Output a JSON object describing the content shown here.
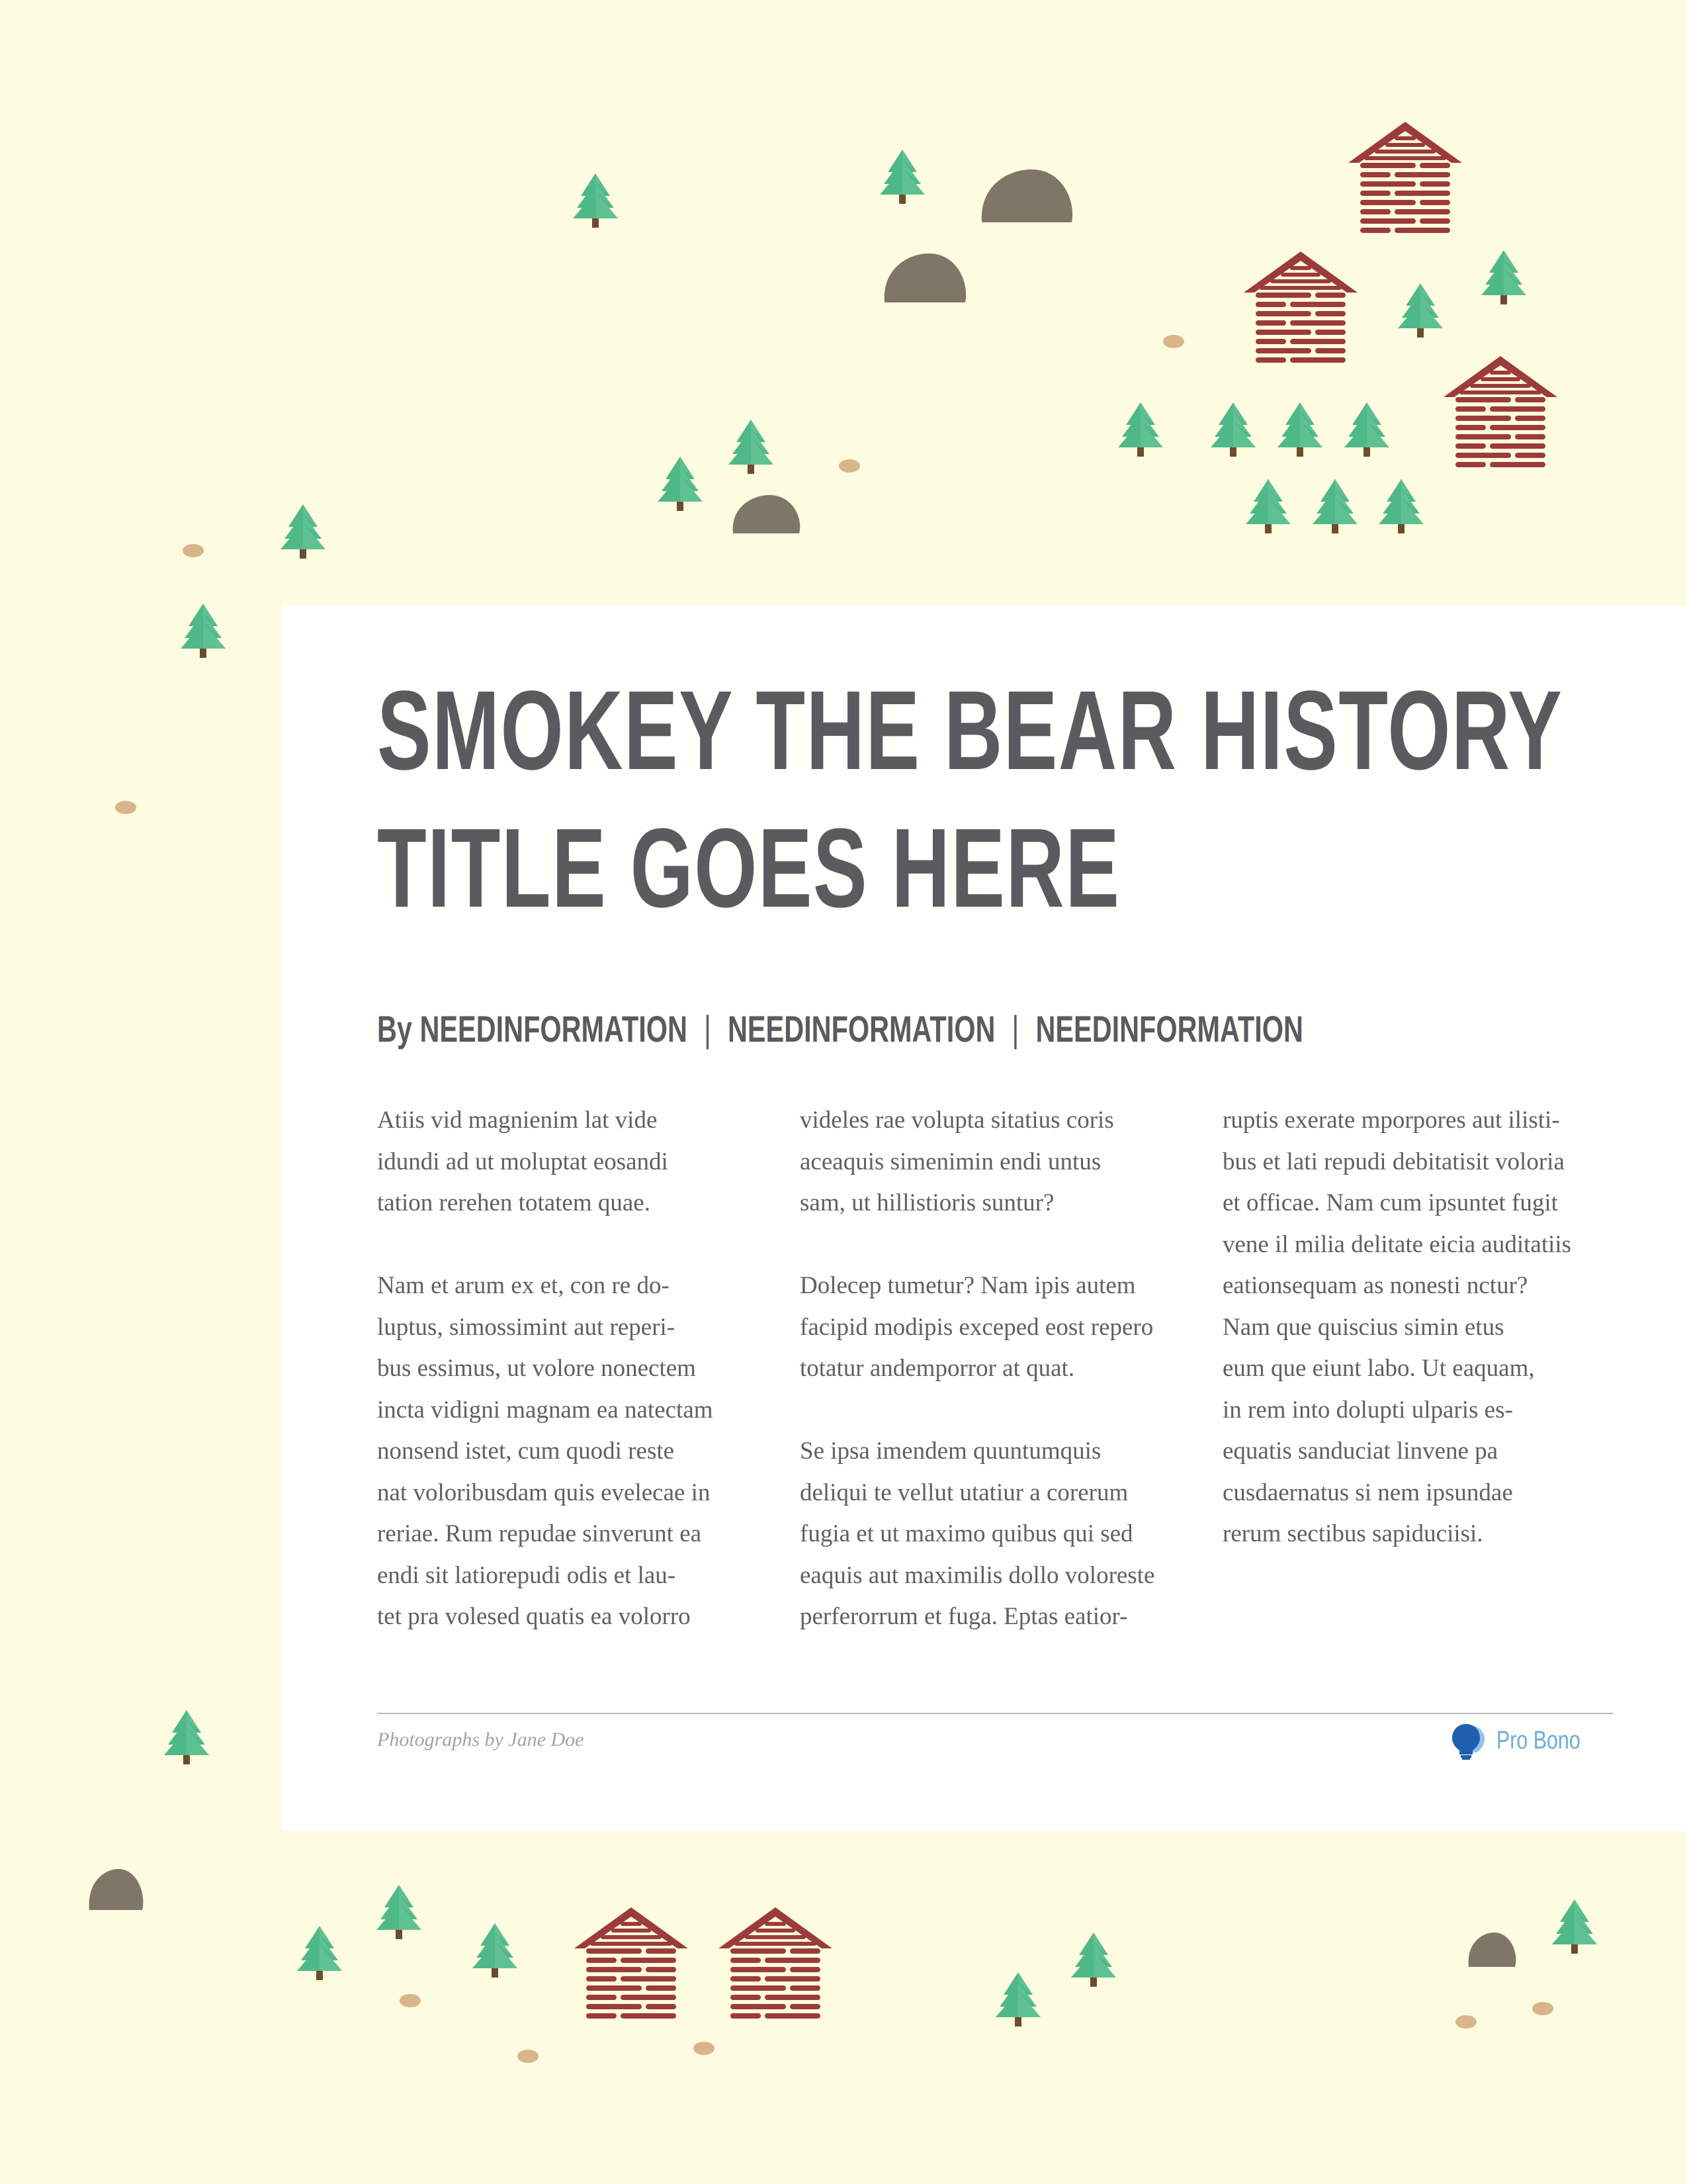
{
  "article": {
    "title_line1": "SMOKEY THE BEAR HISTORY",
    "title_line2": "TITLE GOES HERE",
    "byline": {
      "prefix": "By",
      "name": "NEEDINFORMATION",
      "field2": "NEEDINFORMATION",
      "field3": "NEEDINFORMATION",
      "separator": "|"
    },
    "columns": [
      [
        [
          "Atiis vid magnienim lat vide",
          "idundi ad ut moluptat eosandi",
          "tation rerehen totatem quae."
        ],
        [
          "Nam et arum ex et, con re do-",
          "luptus, simossimint aut reperi-",
          "bus essimus, ut volore nonectem",
          "incta vidigni magnam ea natectam",
          "nonsend istet, cum quodi reste",
          "nat voloribusdam quis evelecae in",
          "reriae. Rum repudae sinverunt ea",
          "endi sit latiorepudi odis et lau-",
          "tet pra volesed quatis ea volorro"
        ]
      ],
      [
        [
          "videles rae volupta sitatius coris",
          "aceaquis simenimin endi untus",
          "sam, ut hillistioris suntur?"
        ],
        [
          "Dolecep tumetur? Nam ipis autem",
          "facipid modipis exceped eost repero",
          "totatur andemporror at quat."
        ],
        [
          "Se ipsa imendem quuntumquis",
          "deliqui te vellut utatiur a corerum",
          "fugia et ut maximo quibus qui sed",
          "eaquis aut maximilis dollo voloreste",
          "perferorrum et fuga. Eptas eatior-"
        ]
      ],
      [
        [
          "ruptis exerate mporpores aut ilisti-",
          "bus et lati repudi debitatisit voloria",
          "et officae. Nam cum ipsuntet fugit",
          "vene il milia delitate eicia auditatiis",
          "eationsequam as nonesti nctur?",
          "Nam que quiscius simin etus",
          "eum que eiunt labo. Ut eaquam,",
          "in rem into dolupti ulparis es-",
          "equatis sanduciat linvene pa",
          "cusdaernatus si nem ipsundae",
          "rerum sectibus sapiduciisi."
        ]
      ]
    ]
  },
  "footer": {
    "credit": "Photographs by Jane Doe",
    "logo_text": "Pro Bono"
  },
  "scene": {
    "icons": [
      "pine-tree-icon",
      "boulder-icon",
      "log-cabin-icon",
      "tree-stump-icon",
      "lightbulb-icon"
    ],
    "colors": {
      "background": "#fdfbe0",
      "card": "#fefefa",
      "tree": "#4fb888",
      "tree_light": "#6cc89d",
      "trunk": "#6e4b2c",
      "rock": "#807668",
      "cabin": "#9c3b3b",
      "stump": "#d8b58a",
      "title_text": "#595b5e",
      "body_text": "#5f6062",
      "logo": "#6aaedc"
    }
  }
}
